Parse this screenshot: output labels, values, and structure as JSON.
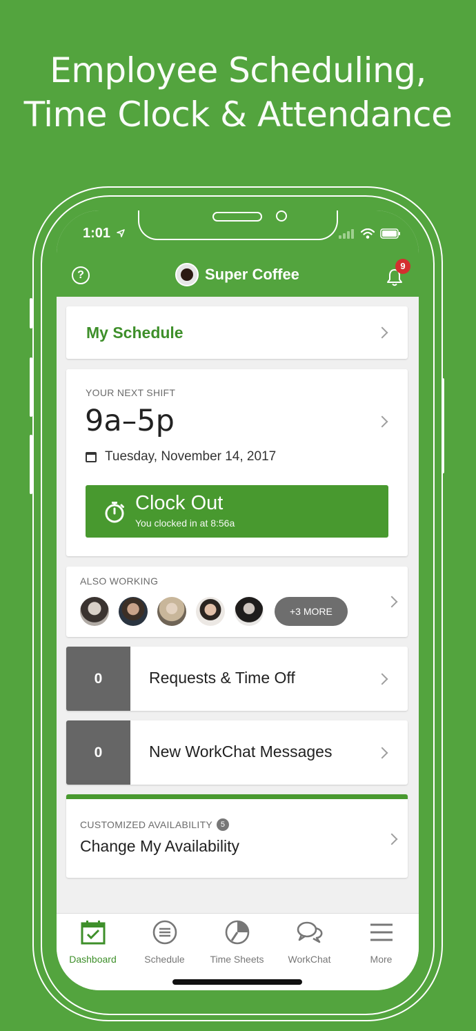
{
  "headline": {
    "line1": "Employee Scheduling,",
    "line2": "Time Clock & Attendance"
  },
  "status_bar": {
    "time": "1:01"
  },
  "app_bar": {
    "company": "Super Coffee",
    "notification_count": "9"
  },
  "my_schedule": {
    "label": "My Schedule"
  },
  "next_shift": {
    "caption": "YOUR NEXT SHIFT",
    "time": "9a–5p",
    "date": "Tuesday, November 14, 2017",
    "clock_button": {
      "label": "Clock Out",
      "sub": "You clocked in at 8:56a"
    }
  },
  "also_working": {
    "caption": "ALSO WORKING",
    "more_label": "+3 MORE"
  },
  "requests": {
    "count": "0",
    "label": "Requests & Time Off"
  },
  "workchat": {
    "count": "0",
    "label": "New WorkChat Messages"
  },
  "availability": {
    "caption": "CUSTOMIZED AVAILABILITY",
    "badge": "5",
    "label": "Change My Availability"
  },
  "tabs": [
    {
      "label": "Dashboard",
      "icon": "dashboard-calendar-icon"
    },
    {
      "label": "Schedule",
      "icon": "schedule-list-icon"
    },
    {
      "label": "Time Sheets",
      "icon": "time-sheets-clock-icon"
    },
    {
      "label": "WorkChat",
      "icon": "chat-bubbles-icon"
    },
    {
      "label": "More",
      "icon": "hamburger-menu-icon"
    }
  ],
  "colors": {
    "brand_green": "#53a43e",
    "button_green": "#48992f",
    "count_gray": "#666666",
    "badge_red": "#d32f2f"
  }
}
